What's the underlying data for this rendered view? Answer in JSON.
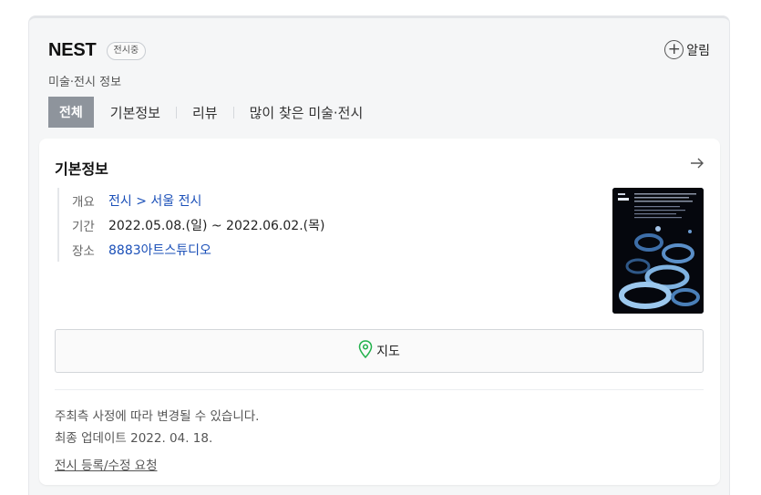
{
  "header": {
    "title": "NEST",
    "badge": "전시중",
    "subtitle": "미술·전시 정보",
    "alarm_label": "알림"
  },
  "tabs": [
    {
      "label": "전체",
      "active": true
    },
    {
      "label": "기본정보",
      "active": false
    },
    {
      "label": "리뷰",
      "active": false
    },
    {
      "label": "많이 찾은 미술·전시",
      "active": false
    }
  ],
  "info_card": {
    "title": "기본정보",
    "rows": {
      "overview": {
        "key": "개요",
        "value": "전시 > 서울 전시"
      },
      "period": {
        "key": "기간",
        "value": "2022.05.08.(일) ~ 2022.06.02.(목)"
      },
      "place": {
        "key": "장소",
        "value": "8883아트스튜디오"
      }
    },
    "map_button_label": "지도",
    "notice": "주최측 사정에 따라 변경될 수 있습니다.",
    "updated": "최종 업데이트 2022. 04. 18.",
    "request_link": "전시 등록/수정 요청"
  },
  "colors": {
    "link": "#1a4fb8",
    "active_tab_bg": "#8e949c",
    "map_pin": "#22b14c"
  },
  "icons": [
    "plus-circle-icon",
    "arrow-right-icon",
    "map-pin-icon"
  ]
}
